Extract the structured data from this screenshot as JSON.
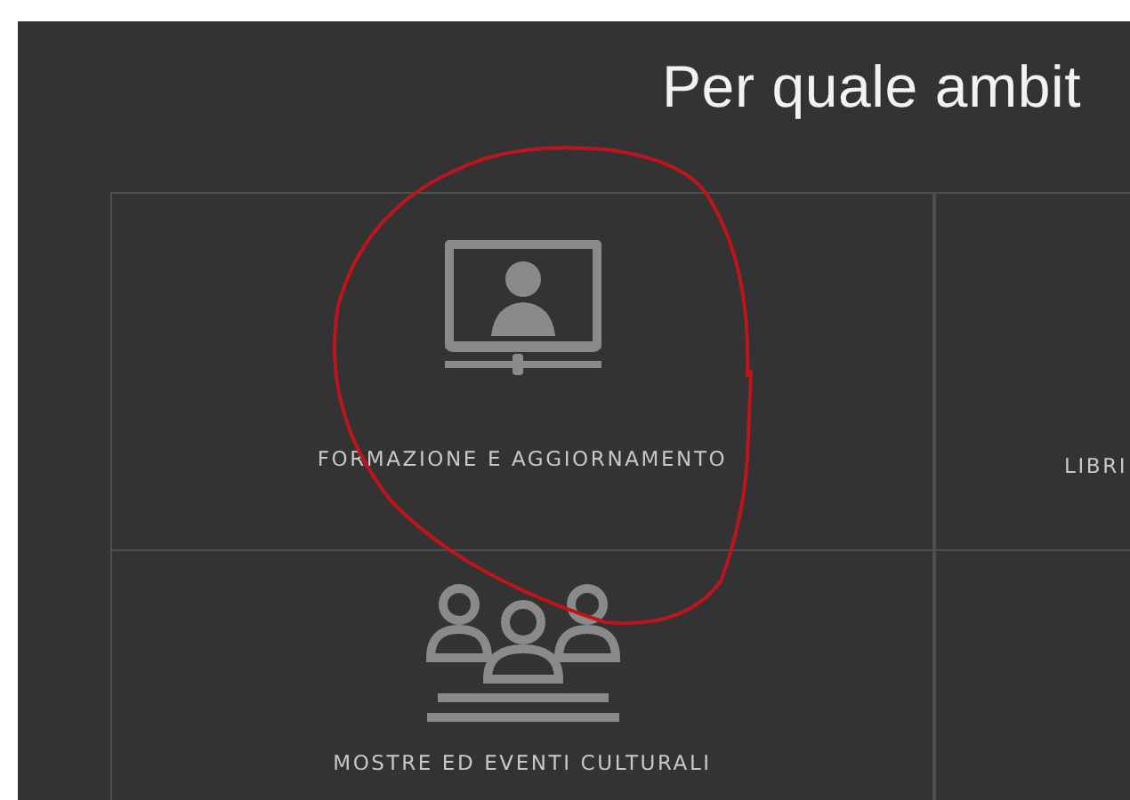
{
  "title": "Per quale ambit",
  "categories": [
    {
      "kind": "monitor",
      "label": "FORMAZIONE E AGGIORNAMENTO"
    },
    {
      "kind": "cut",
      "label": "LIBRI"
    },
    {
      "kind": "audience",
      "label": "MOSTRE ED EVENTI CULTURALI"
    }
  ]
}
